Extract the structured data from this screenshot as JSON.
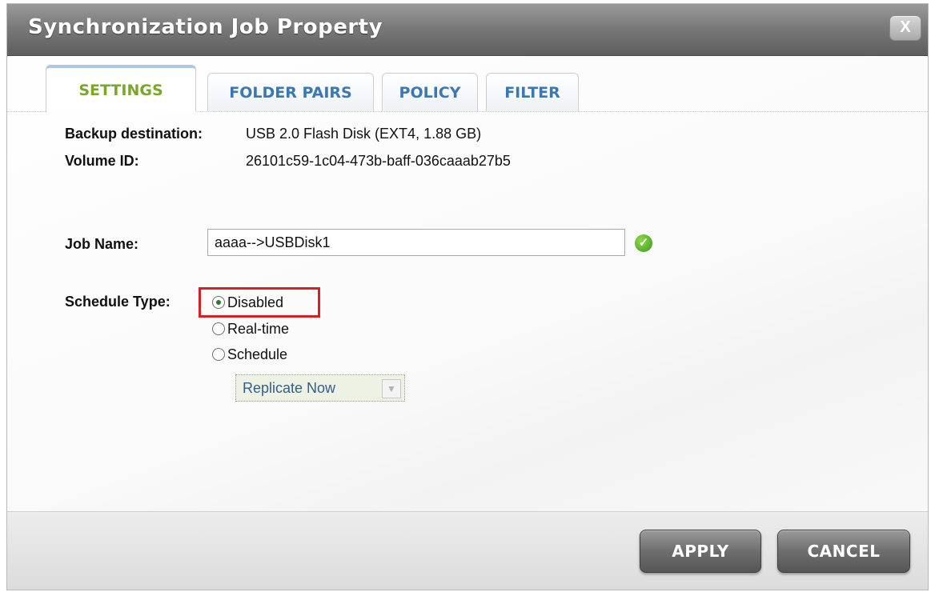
{
  "dialog": {
    "title": "Synchronization Job Property",
    "close_label": "X"
  },
  "tabs": [
    {
      "label": "SETTINGS",
      "active": true
    },
    {
      "label": "FOLDER PAIRS",
      "active": false
    },
    {
      "label": "POLICY",
      "active": false
    },
    {
      "label": "FILTER",
      "active": false
    }
  ],
  "settings": {
    "backup_destination_label": "Backup destination:",
    "backup_destination_value": "USB 2.0 Flash Disk (EXT4, 1.88 GB)",
    "volume_id_label": "Volume ID:",
    "volume_id_value": "26101c59-1c04-473b-baff-036caaab27b5",
    "job_name_label": "Job Name:",
    "job_name_value": "aaaa-->USBDisk1",
    "schedule_type_label": "Schedule Type:",
    "schedule_options": [
      {
        "label": "Disabled",
        "checked": true
      },
      {
        "label": "Real-time",
        "checked": false
      },
      {
        "label": "Schedule",
        "checked": false
      }
    ],
    "replicate_select_value": "Replicate Now"
  },
  "footer": {
    "apply_label": "APPLY",
    "cancel_label": "CANCEL"
  },
  "icons": {
    "valid": "check-circle-icon",
    "dropdown": "chevron-down-icon",
    "close": "close-icon"
  },
  "colors": {
    "active_tab_text": "#7aa62b",
    "tab_text": "#3a78b5",
    "highlight_border": "#d61f26",
    "titlebar": "#7a7a7a"
  }
}
